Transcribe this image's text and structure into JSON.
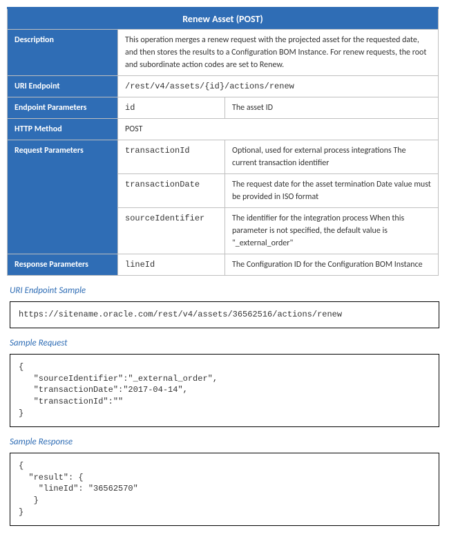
{
  "title": "Renew Asset (POST)",
  "rows": {
    "description": {
      "label": "Description",
      "content": "This operation merges a renew request with the projected asset for the requested date, and then stores the results to a Configuration BOM Instance. For renew requests, the root and subordinate action codes are set to Renew."
    },
    "uriEndpoint": {
      "label": "URI Endpoint",
      "content": "/rest/v4/assets/{id}/actions/renew"
    },
    "endpointParams": {
      "label": "Endpoint Parameters",
      "paramName": "id",
      "paramDesc": "The asset ID"
    },
    "httpMethod": {
      "label": "HTTP Method",
      "content": "POST"
    },
    "requestParams": {
      "label": "Request Parameters",
      "items": [
        {
          "name": "transactionId",
          "desc": "Optional, used for external process integrations\nThe current transaction identifier"
        },
        {
          "name": "transactionDate",
          "desc": "The request date for the asset termination\nDate value must be provided in ISO format"
        },
        {
          "name": "sourceIdentifier",
          "desc": "The identifier for the integration process\nWhen this parameter is not specified, the default value is \"_external_order\""
        }
      ]
    },
    "responseParams": {
      "label": "Response Parameters",
      "paramName": "lineId",
      "paramDesc": "The Configuration ID for the Configuration BOM Instance"
    }
  },
  "sections": {
    "endpointSample": {
      "heading": "URI Endpoint Sample",
      "code": "https://sitename.oracle.com/rest/v4/assets/36562516/actions/renew"
    },
    "sampleRequest": {
      "heading": "Sample Request",
      "code": "{\n   \"sourceIdentifier\":\"_external_order\",\n   \"transactionDate\":\"2017-04-14\",\n   \"transactionId\":\"\"\n}"
    },
    "sampleResponse": {
      "heading": "Sample Response",
      "code": "{\n  \"result\": {\n    \"lineId\": \"36562570\"\n   }\n}"
    }
  }
}
